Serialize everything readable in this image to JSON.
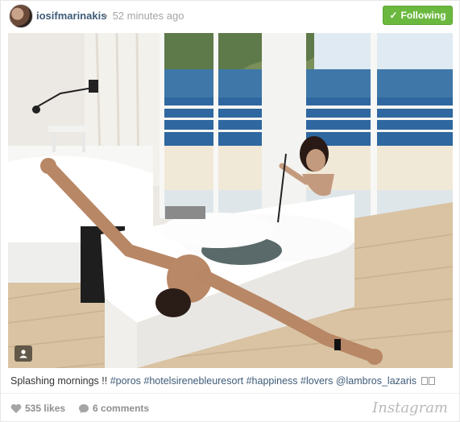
{
  "post": {
    "username": "iosifmarinakis",
    "separator": "•",
    "time_ago": "52 minutes ago",
    "follow_label": "Following",
    "follow_color": "#6bb83f"
  },
  "caption": {
    "text": "Splashing mornings !! ",
    "tags": [
      "#poros",
      "#hotelsirenebleuresort",
      "#happiness",
      "#lovers",
      "@lambros_lazaris"
    ]
  },
  "stats": {
    "likes": "535 likes",
    "comments": "6 comments"
  },
  "brand": "Instagram",
  "icons": {
    "follow": "check-icon",
    "badge": "user-icon",
    "likes": "heart-icon",
    "comments": "comment-icon"
  }
}
